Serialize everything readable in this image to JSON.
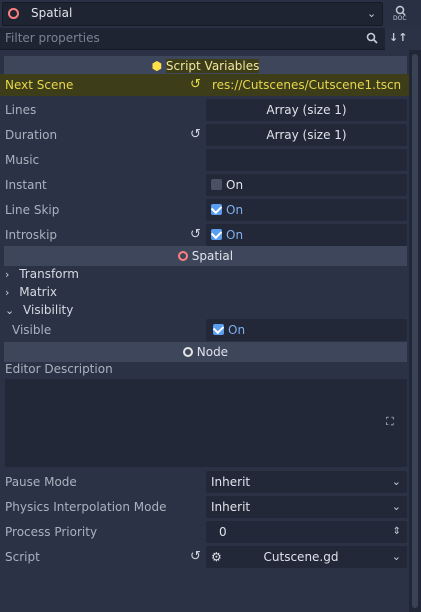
{
  "header": {
    "object_label": "Spatial",
    "doc_label": "DOC"
  },
  "filter": {
    "placeholder": "Filter properties"
  },
  "script_vars": {
    "section_label": "Script Variables",
    "next_scene": {
      "label": "Next Scene",
      "value": "res://Cutscenes/Cutscene1.tscn"
    },
    "lines": {
      "label": "Lines",
      "value": "Array (size 1)"
    },
    "duration": {
      "label": "Duration",
      "value": "Array (size 1)"
    },
    "music": {
      "label": "Music",
      "value": ""
    },
    "instant": {
      "label": "Instant",
      "value": "On"
    },
    "line_skip": {
      "label": "Line Skip",
      "value": "On"
    },
    "introskip": {
      "label": "Introskip",
      "value": "On"
    }
  },
  "spatial": {
    "section_label": "Spatial",
    "groups": [
      "Transform",
      "Matrix",
      "Visibility"
    ],
    "visible": {
      "label": "Visible",
      "value": "On"
    }
  },
  "node": {
    "section_label": "Node",
    "editor_description": "Editor Description",
    "pause_mode": {
      "label": "Pause Mode",
      "value": "Inherit"
    },
    "physics_mode": {
      "label": "Physics Interpolation Mode",
      "value": "Inherit"
    },
    "process_priority": {
      "label": "Process Priority",
      "value": "0"
    },
    "script": {
      "label": "Script",
      "value": "Cutscene.gd"
    }
  },
  "colors": {
    "highlight": "#3d3d1a",
    "accent_yellow": "#ffe04a",
    "checkbox_on": "#5a9ef0",
    "spatial_red": "#fc7f7f"
  }
}
